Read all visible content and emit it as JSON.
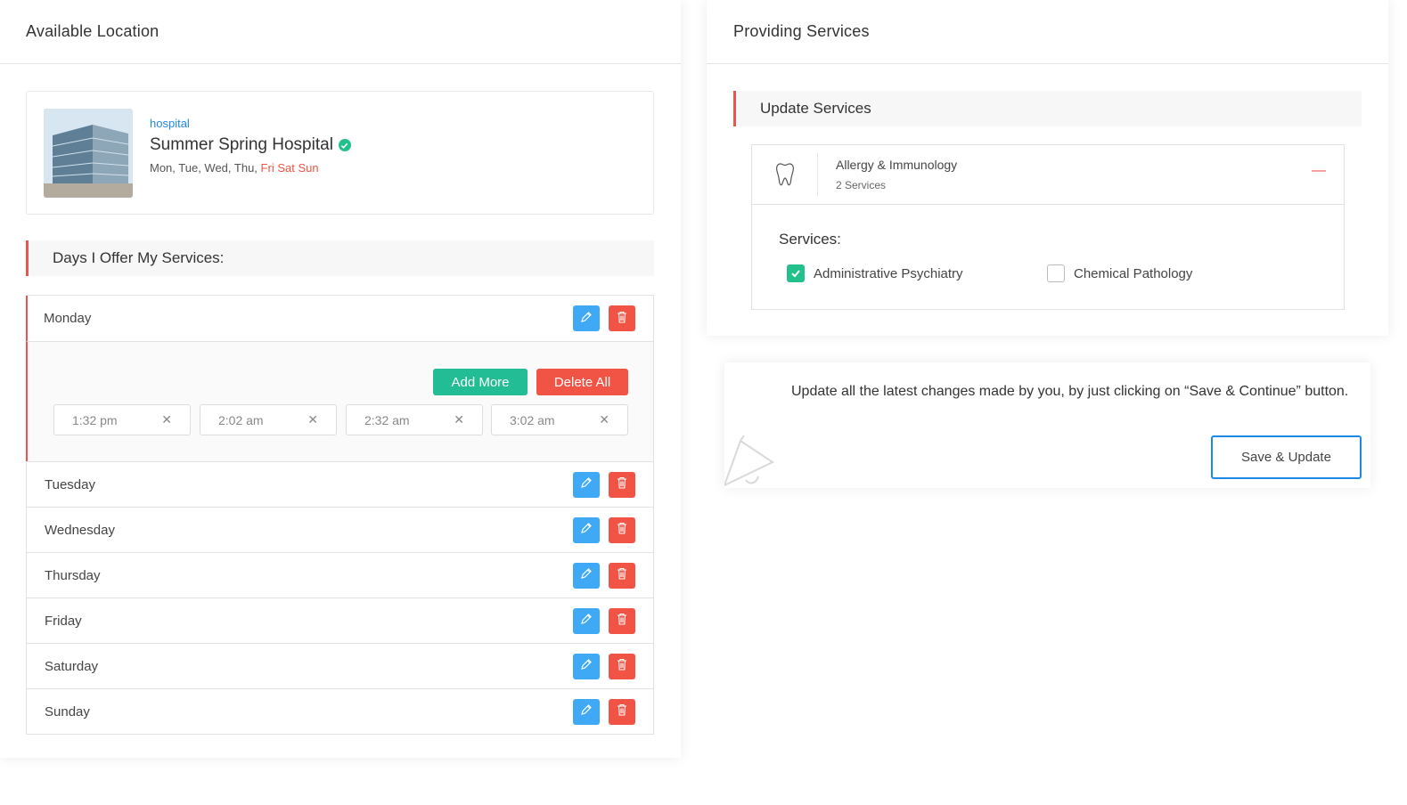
{
  "left_panel": {
    "title": "Available Location",
    "location": {
      "type": "hospital",
      "name": "Summer Spring Hospital",
      "days_open": "Mon, Tue, Wed, Thu,",
      "days_closed": "Fri Sat Sun"
    },
    "days_heading": "Days I Offer My Services:",
    "days": [
      {
        "label": "Monday",
        "expanded": true
      },
      {
        "label": "Tuesday"
      },
      {
        "label": "Wednesday"
      },
      {
        "label": "Thursday"
      },
      {
        "label": "Friday"
      },
      {
        "label": "Saturday"
      },
      {
        "label": "Sunday"
      }
    ],
    "expanded_day": {
      "add_more_label": "Add More",
      "delete_all_label": "Delete All",
      "times": [
        "1:32 pm",
        "2:02 am",
        "2:32 am",
        "3:02 am"
      ],
      "clear_glyph": "✕"
    }
  },
  "right_panel": {
    "title": "Providing Services",
    "update_heading": "Update Services",
    "category": {
      "icon": "tooth-icon",
      "name": "Allergy & Immunology",
      "count": "2 Services",
      "collapse_glyph": "—"
    },
    "services_label": "Services:",
    "services": [
      {
        "label": "Administrative Psychiatry",
        "checked": true
      },
      {
        "label": "Chemical Pathology",
        "checked": false
      }
    ]
  },
  "save_card": {
    "message": "Update all the latest changes made by you, by just clicking on “Save & Continue” button.",
    "button_label": "Save & Update"
  },
  "colors": {
    "accent_red": "#ef5350",
    "edit_blue": "#3fa9f5",
    "delete_red": "#f15345",
    "success_green": "#22bc95",
    "link_blue": "#1e88e5"
  }
}
